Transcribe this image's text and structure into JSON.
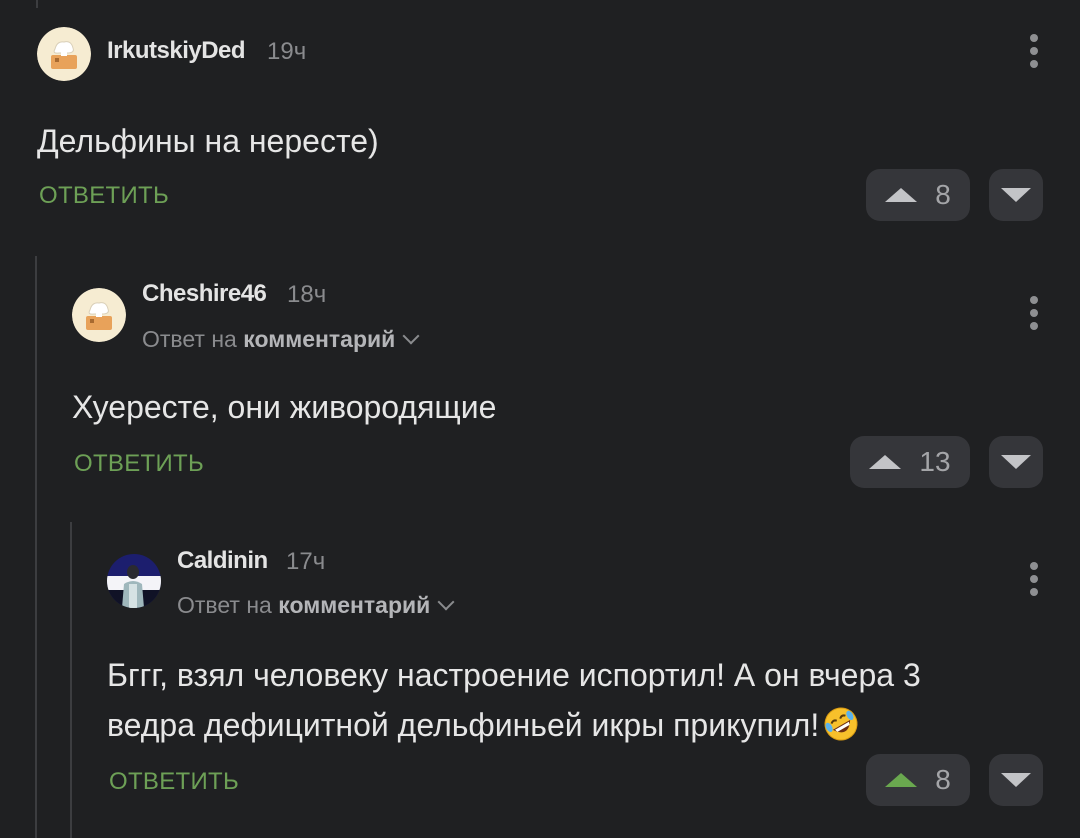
{
  "comments": [
    {
      "author": "IrkutskiyDed",
      "time": "19ч",
      "text": "Дельфины на нересте)",
      "reply_label": "ОТВЕТИТЬ",
      "votes": "8",
      "upvoted": false
    },
    {
      "author": "Cheshire46",
      "time": "18ч",
      "reply_prefix": "Ответ на",
      "reply_link": "комментарий",
      "text": "Хуересте, они живородящие",
      "reply_label": "ОТВЕТИТЬ",
      "votes": "13",
      "upvoted": false
    },
    {
      "author": "Caldinin",
      "time": "17ч",
      "reply_prefix": "Ответ на",
      "reply_link": "комментарий",
      "text_line1": "Бггг, взял человеку настроение испортил! А он вчера 3",
      "text_line2": "ведра дефицитной дельфиньей икры прикупил!",
      "emoji": "rolling-on-floor-laughing-emoji",
      "reply_label": "ОТВЕТИТЬ",
      "votes": "8",
      "upvoted": true
    }
  ],
  "colors": {
    "background": "#1f2022",
    "reply_green": "#6da056",
    "upvote_active": "#6aa84f",
    "button_bg": "#35363a"
  }
}
